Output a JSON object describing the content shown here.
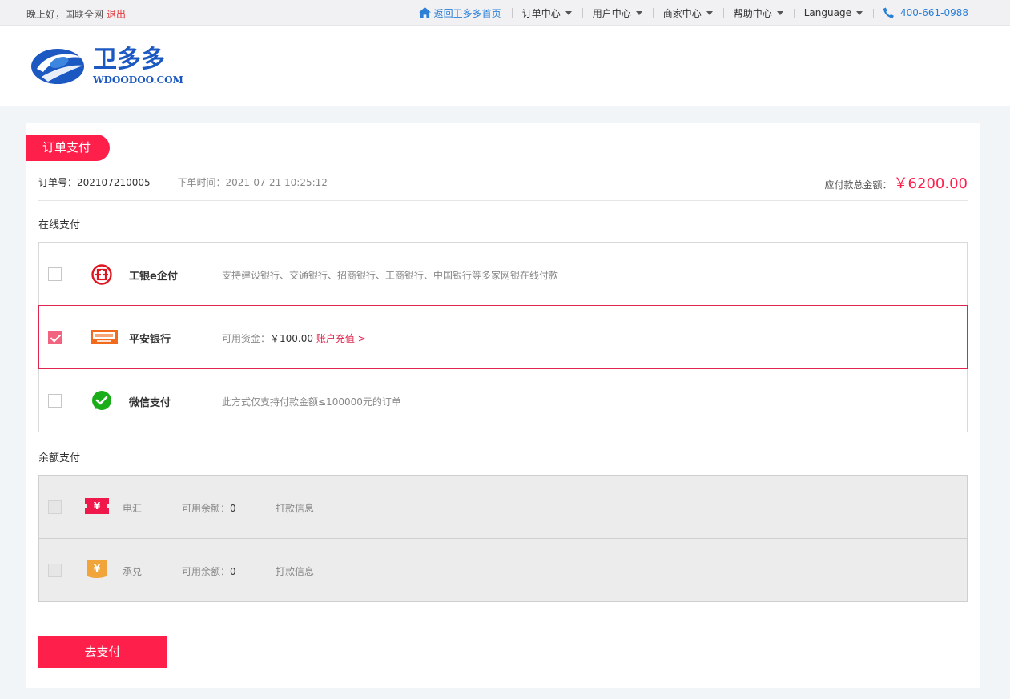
{
  "topbar": {
    "greeting": "晚上好，国联全网",
    "logout": "退出",
    "nav": {
      "home": "返回卫多多首页",
      "orders": "订单中心",
      "user": "用户中心",
      "merchant": "商家中心",
      "help": "帮助中心",
      "language": "Language",
      "phone": "400-661-0988"
    }
  },
  "logo": {
    "name_cn": "卫多多",
    "name_en": "WDOODOO.COM"
  },
  "order": {
    "tag": "订单支付",
    "number_label": "订单号：",
    "number": "202107210005",
    "time_label": "下单时间：",
    "time": "2021-07-21 10:25:12",
    "total_label": "应付款总金额：",
    "total": "￥6200.00"
  },
  "online": {
    "label": "在线支付",
    "methods": [
      {
        "name": "工银e企付",
        "desc": "支持建设银行、交通银行、招商银行、工商银行、中国银行等多家网银在线付款",
        "checked": false,
        "icon": "icbc-icon"
      },
      {
        "name": "平安银行",
        "desc_label": "可用资金：",
        "desc_value": "￥100.00",
        "link": "账户充值 >",
        "checked": true,
        "icon": "pingan-icon"
      },
      {
        "name": "微信支付",
        "desc": "此方式仅支持付款金额≤100000元的订单",
        "checked": false,
        "icon": "wechat-icon"
      }
    ]
  },
  "balance": {
    "label": "余额支付",
    "methods": [
      {
        "name": "电汇",
        "avail_label": "可用余额：",
        "avail_value": "0",
        "info": "打款信息",
        "icon": "wire-transfer-icon",
        "color": "#f0184b"
      },
      {
        "name": "承兑",
        "avail_label": "可用余额：",
        "avail_value": "0",
        "info": "打款信息",
        "icon": "acceptance-icon",
        "color": "#f0a43a"
      }
    ]
  },
  "submit": "去支付",
  "colors": {
    "accent": "#ff1f4b",
    "link": "#2b7fd6"
  }
}
